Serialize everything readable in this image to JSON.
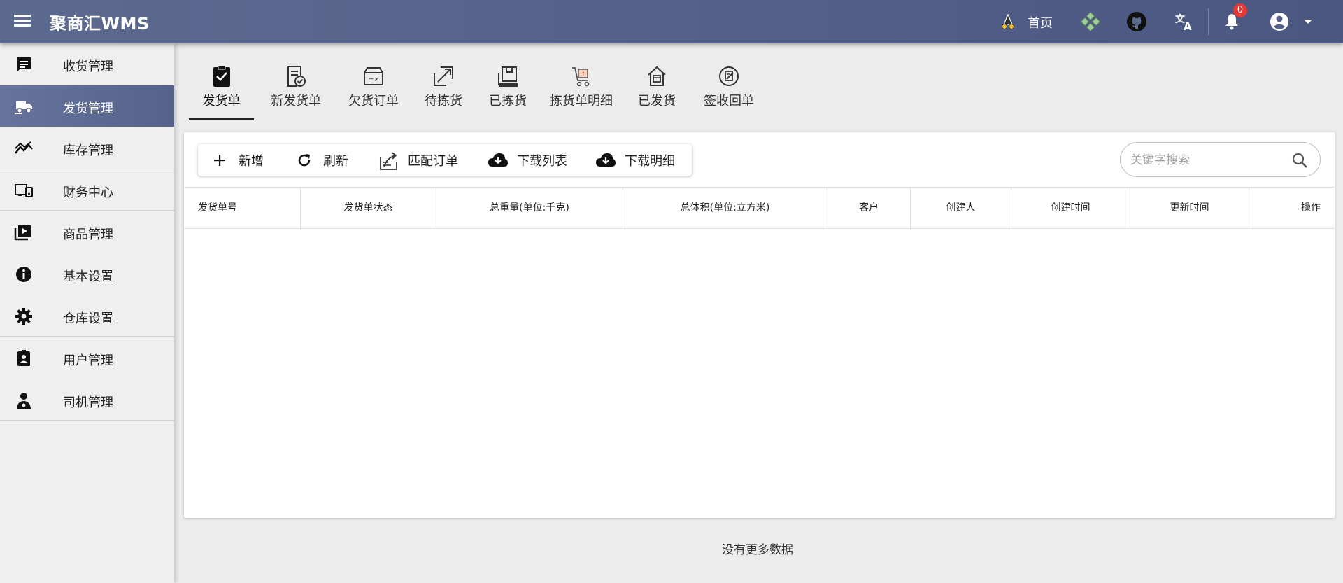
{
  "header": {
    "app_title": "聚商汇WMS",
    "home_label": "首页",
    "notification_count": "0",
    "colors": {
      "bar": "#54618a",
      "badge": "#e53935"
    }
  },
  "sidebar": {
    "items": [
      {
        "label": "收货管理",
        "icon": "receipt-list-icon",
        "active": false
      },
      {
        "label": "发货管理",
        "icon": "delivery-truck-icon",
        "active": true
      },
      {
        "label": "库存管理",
        "icon": "trending-icon",
        "active": false
      },
      {
        "label": "财务中心",
        "icon": "devices-icon",
        "active": false
      },
      {
        "label": "商品管理",
        "icon": "video-library-icon",
        "active": false
      },
      {
        "label": "基本设置",
        "icon": "info-icon",
        "active": false
      },
      {
        "label": "仓库设置",
        "icon": "gear-icon",
        "active": false
      },
      {
        "label": "用户管理",
        "icon": "badge-icon",
        "active": false
      },
      {
        "label": "司机管理",
        "icon": "driver-icon",
        "active": false
      }
    ]
  },
  "tabs": [
    {
      "label": "发货单",
      "icon": "order-check-icon",
      "active": true
    },
    {
      "label": "新发货单",
      "icon": "new-order-icon",
      "active": false
    },
    {
      "label": "欠货订单",
      "icon": "box-x-icon",
      "active": false
    },
    {
      "label": "待拣货",
      "icon": "pick-arrow-icon",
      "active": false
    },
    {
      "label": "已拣货",
      "icon": "picked-box-icon",
      "active": false
    },
    {
      "label": "拣货单明细",
      "icon": "cart-detail-icon",
      "active": false
    },
    {
      "label": "已发货",
      "icon": "shipped-house-icon",
      "active": false
    },
    {
      "label": "签收回单",
      "icon": "sign-receipt-icon",
      "active": false
    }
  ],
  "toolbar": {
    "add_label": "新增",
    "refresh_label": "刷新",
    "match_label": "匹配订单",
    "download_list_label": "下载列表",
    "download_detail_label": "下载明细"
  },
  "search": {
    "placeholder": "关键字搜索",
    "value": ""
  },
  "table": {
    "columns": [
      "发货单号",
      "发货单状态",
      "总重量(单位:千克)",
      "总体积(单位:立方米)",
      "客户",
      "创建人",
      "创建时间",
      "更新时间",
      "操作"
    ],
    "rows": []
  },
  "footer": {
    "no_more_text": "没有更多数据"
  }
}
